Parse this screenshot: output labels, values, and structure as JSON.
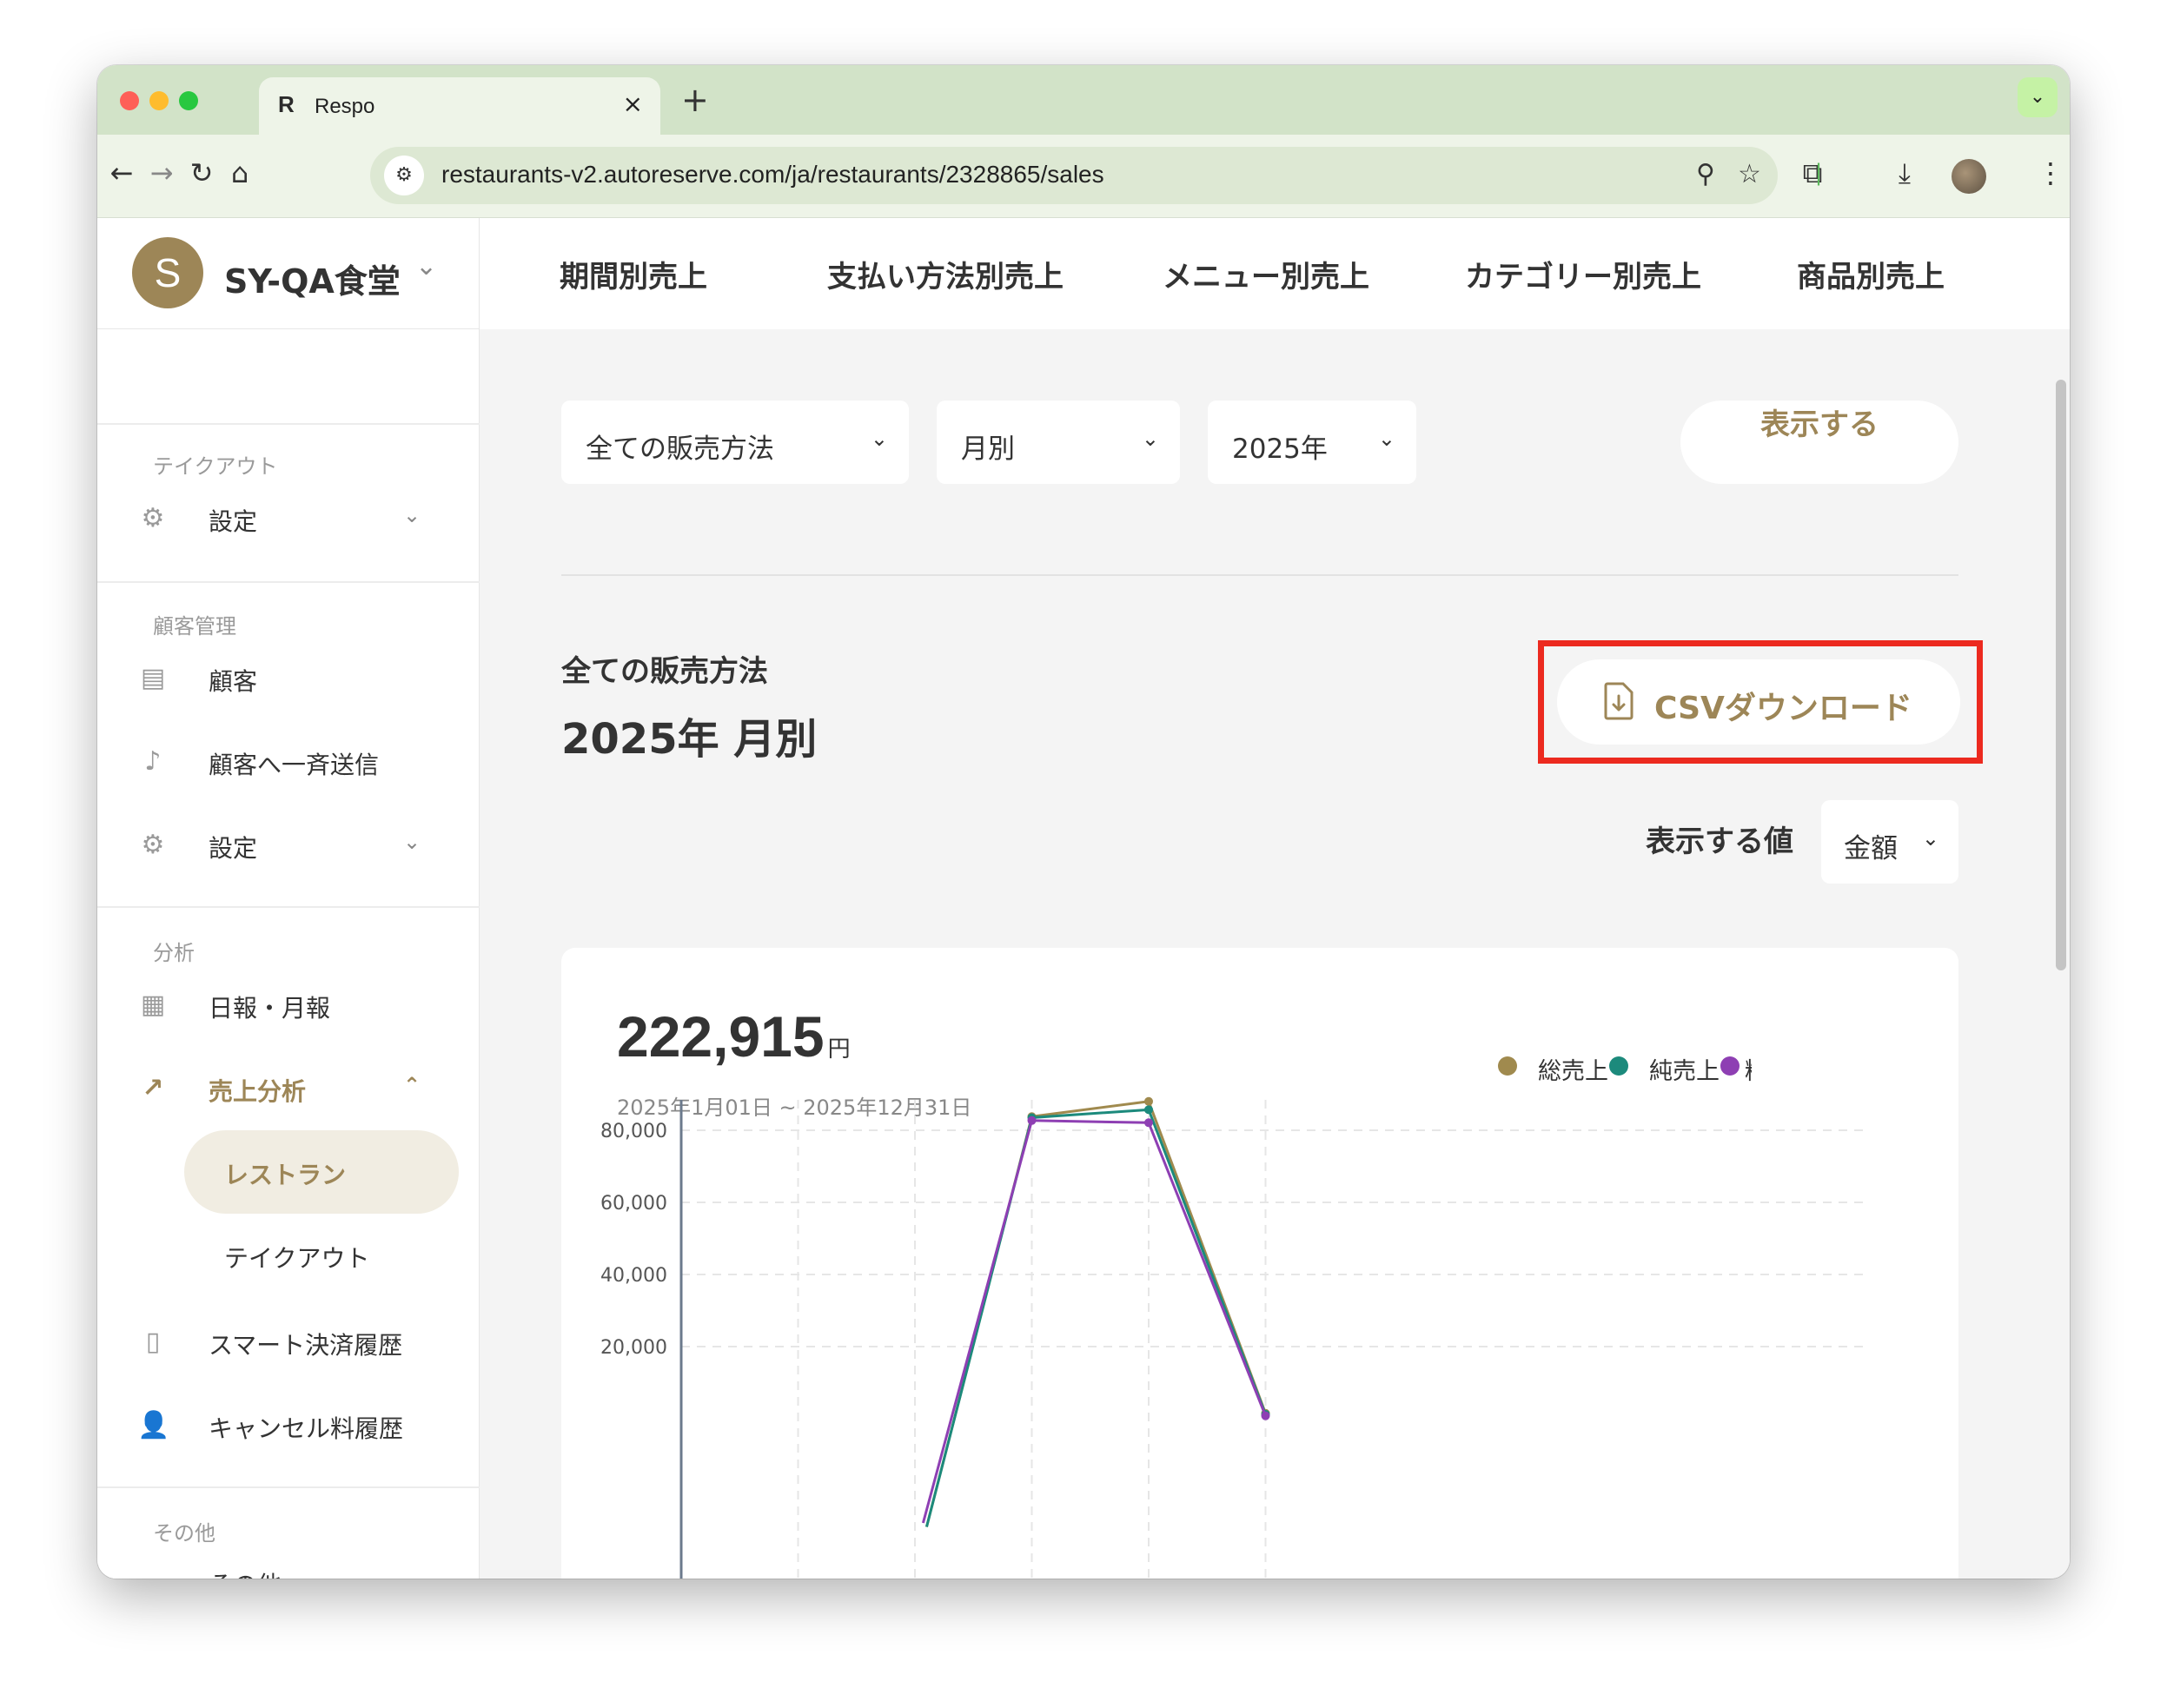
{
  "browser": {
    "tab_title": "Respo",
    "favicon_text": "R",
    "url": "restaurants-v2.autoreserve.com/ja/restaurants/2328865/sales",
    "icons": [
      "back-icon",
      "forward-icon",
      "reload-icon",
      "home-icon",
      "site-info-icon",
      "zoom-icon",
      "bookmark-star-icon",
      "extensions-icon",
      "download-icon",
      "profile-avatar",
      "more-menu-icon"
    ]
  },
  "sidebar": {
    "store_initial": "S",
    "store_name": "SY-QA食堂",
    "sections": {
      "takeout": "テイクアウト",
      "customer": "顧客管理",
      "analysis": "分析",
      "other": "その他"
    },
    "items": {
      "takeout_settings": "設定",
      "customers": "顧客",
      "broadcast": "顧客へ一斉送信",
      "customer_settings": "設定",
      "daily_report": "日報・月報",
      "sales_analysis": "売上分析",
      "restaurant": "レストラン",
      "takeout": "テイクアウト",
      "smart_payment": "スマート決済履歴",
      "cancel_fee": "キャンセル料履歴",
      "other": "その他"
    }
  },
  "topnav": [
    "期間別売上",
    "支払い方法別売上",
    "メニュー別売上",
    "カテゴリー別売上",
    "商品別売上"
  ],
  "filters": {
    "sales_method": "全ての販売方法",
    "period": "月別",
    "year": "2025年",
    "show_button": "表示する"
  },
  "report": {
    "subtitle": "全ての販売方法",
    "title": "2025年 月別",
    "csv_button": "CSVダウンロード",
    "value_label": "表示する値",
    "value_select": "金額",
    "total": "222,915",
    "total_unit": "円",
    "range": "2025年1月01日 ~ 2025年12月31日"
  },
  "colors": {
    "brand": "#9d8657",
    "highlight": "#ec2a1f",
    "series_gross": "#a08a4e",
    "series_net": "#1c8a7c",
    "series_third": "#8e3fb3"
  },
  "chart_data": {
    "type": "line",
    "title": "",
    "xlabel": "",
    "ylabel": "",
    "ylim": [
      0,
      85000
    ],
    "yticks": [
      "80,000",
      "60,000",
      "40,000",
      "20,000"
    ],
    "grid": true,
    "legend_placement": "top-right",
    "x": [
      1,
      2,
      3,
      4,
      5,
      6
    ],
    "series": [
      {
        "name": "総売上",
        "color": "#a08a4e",
        "values": [
          null,
          null,
          null,
          83800,
          88000,
          1500
        ]
      },
      {
        "name": "純売上",
        "color": "#1c8a7c",
        "values": [
          null,
          null,
          null,
          83500,
          85700,
          1200
        ]
      },
      {
        "name": "精",
        "color": "#8e3fb3",
        "values": [
          null,
          null,
          null,
          82700,
          82100,
          800
        ]
      }
    ],
    "third_series_segment_start": {
      "x": 3.07,
      "y": 0
    }
  }
}
